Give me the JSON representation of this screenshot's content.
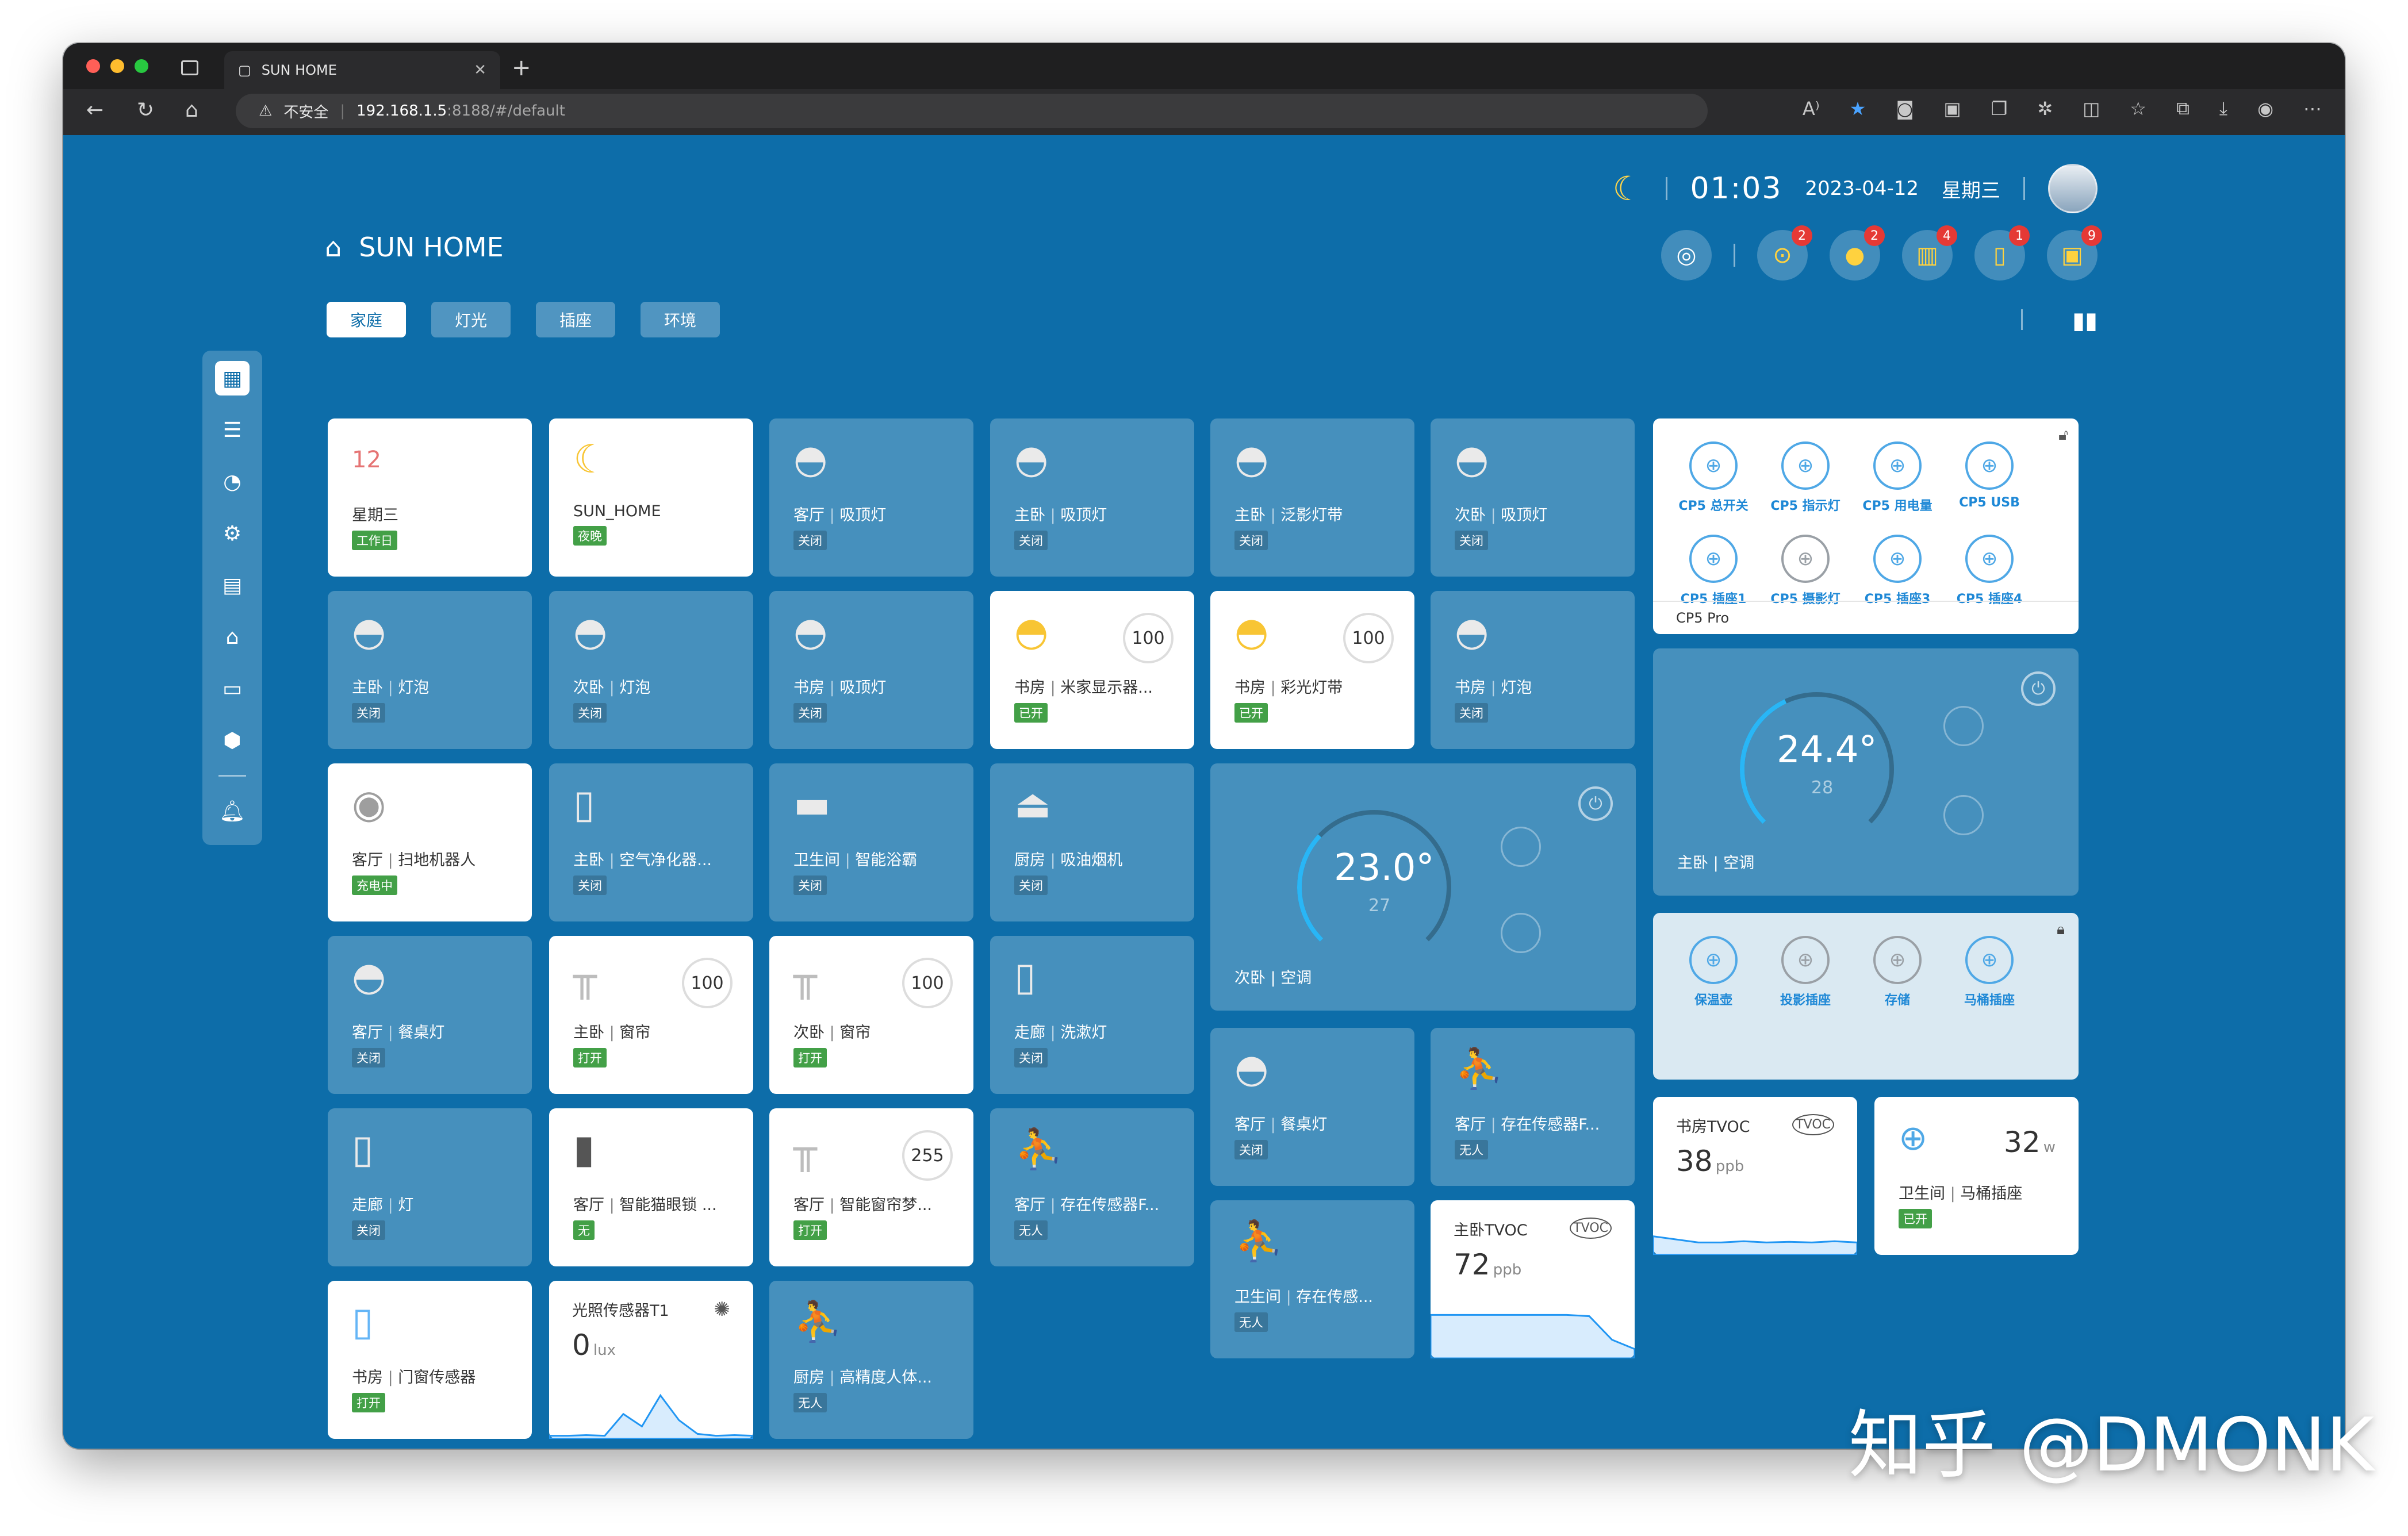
{
  "browser": {
    "tab_title": "SUN HOME",
    "security": "不安全",
    "host": "192.168.1.5",
    "path": ":8188/#/default"
  },
  "header": {
    "time": "01:03",
    "date": "2023-04-12",
    "weekday": "星期三",
    "app_title": "SUN HOME",
    "status_badges": [
      "2",
      "2",
      "4",
      "1",
      "9"
    ]
  },
  "tabs": [
    "家庭",
    "灯光",
    "插座",
    "环境"
  ],
  "cards": {
    "calendar": {
      "day": "12",
      "name": "星期三",
      "state": "工作日"
    },
    "mode": {
      "name": "SUN_HOME",
      "state": "夜晚"
    },
    "c3": {
      "room": "客厅",
      "name": "吸顶灯",
      "state": "关闭"
    },
    "c4": {
      "room": "主卧",
      "name": "吸顶灯",
      "state": "关闭"
    },
    "c5": {
      "room": "主卧",
      "name": "泛影灯带",
      "state": "关闭"
    },
    "c6": {
      "room": "次卧",
      "name": "吸顶灯",
      "state": "关闭"
    },
    "c7": {
      "room": "主卧",
      "name": "灯泡",
      "state": "关闭"
    },
    "c8": {
      "room": "次卧",
      "name": "灯泡",
      "state": "关闭"
    },
    "c9": {
      "room": "书房",
      "name": "吸顶灯",
      "state": "关闭"
    },
    "c10": {
      "room": "书房",
      "name": "米家显示器...",
      "state": "已开",
      "level": "100"
    },
    "c11": {
      "room": "书房",
      "name": "彩光灯带",
      "state": "已开",
      "level": "100"
    },
    "c12": {
      "room": "书房",
      "name": "灯泡",
      "state": "关闭"
    },
    "c13": {
      "room": "客厅",
      "name": "扫地机器人",
      "state": "充电中"
    },
    "c14": {
      "room": "主卧",
      "name": "空气净化器...",
      "state": "关闭"
    },
    "c15": {
      "room": "卫生间",
      "name": "智能浴霸",
      "state": "关闭"
    },
    "c16": {
      "room": "厨房",
      "name": "吸油烟机",
      "state": "关闭"
    },
    "c17": {
      "room": "客厅",
      "name": "餐桌灯",
      "state": "关闭"
    },
    "c18": {
      "room": "主卧",
      "name": "窗帘",
      "state": "打开",
      "level": "100"
    },
    "c19": {
      "room": "次卧",
      "name": "窗帘",
      "state": "打开",
      "level": "100"
    },
    "c20": {
      "room": "走廊",
      "name": "洗漱灯",
      "state": "关闭"
    },
    "c21": {
      "room": "走廊",
      "name": "灯",
      "state": "关闭"
    },
    "c22": {
      "room": "客厅",
      "name": "智能猫眼锁 ...",
      "state": "无"
    },
    "c23": {
      "room": "客厅",
      "name": "智能窗帘梦...",
      "state": "打开",
      "level": "255"
    },
    "c24": {
      "room": "客厅",
      "name": "存在传感器F...",
      "state": "无人"
    },
    "c25": {
      "room": "书房",
      "name": "门窗传感器",
      "state": "打开"
    },
    "c27": {
      "room": "厨房",
      "name": "高精度人体...",
      "state": "无人"
    },
    "c28": {
      "room": "客厅",
      "name": "餐桌灯",
      "state": "关闭"
    },
    "c29": {
      "room": "客厅",
      "name": "存在传感器F...",
      "state": "无人"
    },
    "c30": {
      "room": "卫生间",
      "name": "存在传感...",
      "state": "无人"
    }
  },
  "light_sensor": {
    "title": "光照传感器T1",
    "value": "0",
    "unit": "lux",
    "curve": [
      0.05,
      0.05,
      0.06,
      0.05,
      0.4,
      0.2,
      0.7,
      0.3,
      0.08,
      0.05,
      0.06,
      0.05
    ]
  },
  "thermostat_second": {
    "value": "23.0°",
    "target": "27",
    "room": "次卧",
    "name": "空调"
  },
  "thermostat_master": {
    "value": "24.4°",
    "target": "28",
    "room": "主卧",
    "name": "空调"
  },
  "cp5": {
    "labels": [
      "CP5 总开关",
      "CP5 指示灯",
      "CP5 用电量",
      "CP5 USB",
      "CP5 插座1",
      "CP5 摄影灯",
      "CP5 插座3",
      "CP5 插座4"
    ],
    "off_index": 5,
    "footer": "CP5 Pro"
  },
  "plugs": {
    "labels": [
      "保温壶",
      "投影插座",
      "存储",
      "马桶插座"
    ],
    "off_indexes": [
      1,
      2
    ]
  },
  "tvoc_study": {
    "title": "书房TVOC",
    "value": "38",
    "unit": "ppb",
    "curve": [
      0.3,
      0.25,
      0.2,
      0.2,
      0.22,
      0.2,
      0.21,
      0.2,
      0.22,
      0.2
    ]
  },
  "tvoc_master": {
    "title": "主卧TVOC",
    "value": "72",
    "unit": "ppb",
    "curve": [
      0.7,
      0.7,
      0.7,
      0.7,
      0.7,
      0.7,
      0.7,
      0.68,
      0.3,
      0.15
    ]
  },
  "toilet_plug": {
    "room": "卫生间",
    "name": "马桶插座",
    "value": "32",
    "unit": "w",
    "state": "已开"
  },
  "watermark": "知乎 @DMONK"
}
